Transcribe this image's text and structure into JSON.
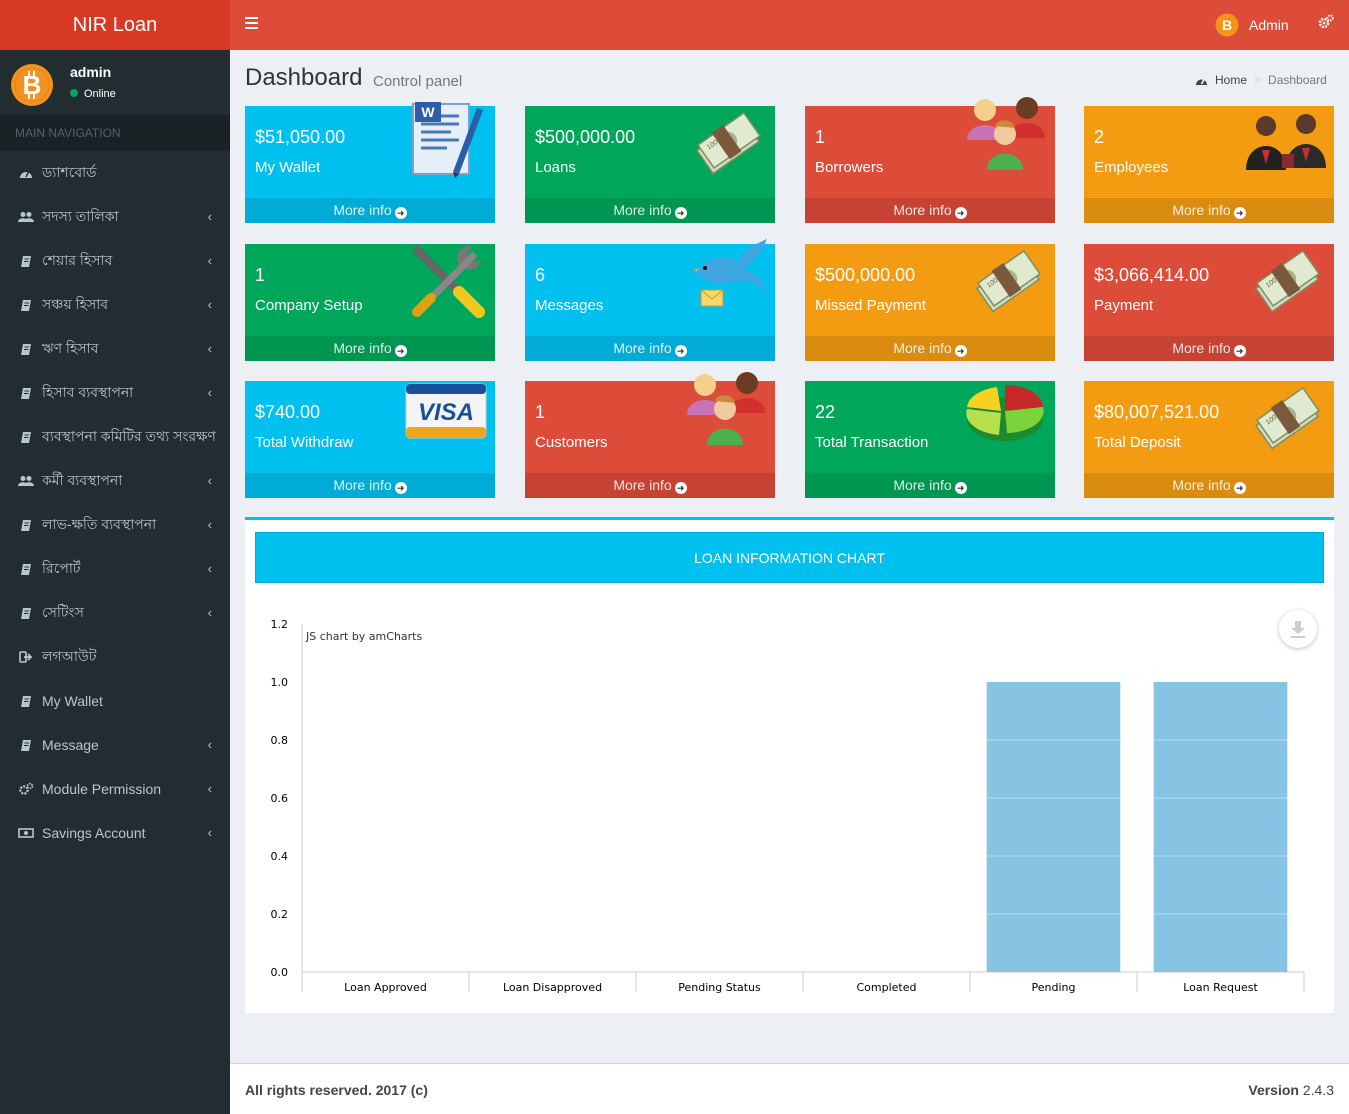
{
  "app": {
    "brand": "NIR Loan"
  },
  "user": {
    "name": "admin",
    "status": "Online"
  },
  "sidebar": {
    "header": "MAIN NAVIGATION",
    "items": [
      {
        "label": "ড্যাশবোর্ড",
        "icon": "dashboard-icon",
        "chevron": false
      },
      {
        "label": "সদস্য তালিকা",
        "icon": "users-icon",
        "chevron": true
      },
      {
        "label": "শেয়ার হিসাব",
        "icon": "book-icon",
        "chevron": true
      },
      {
        "label": "সঞ্চয় হিসাব",
        "icon": "book-icon",
        "chevron": true
      },
      {
        "label": "ঋণ হিসাব",
        "icon": "book-icon",
        "chevron": true
      },
      {
        "label": "হিসাব ব্যবস্থাপনা",
        "icon": "book-icon",
        "chevron": true
      },
      {
        "label": "ব্যবস্থাপনা কমিটির তথ্য সংরক্ষণ",
        "icon": "book-icon",
        "chevron": false
      },
      {
        "label": "কর্মী ব্যবস্থাপনা",
        "icon": "users-icon",
        "chevron": true
      },
      {
        "label": "লাভ-ক্ষতি ব্যবস্থাপনা",
        "icon": "book-icon",
        "chevron": true
      },
      {
        "label": "রিপোর্ট",
        "icon": "book-icon",
        "chevron": true
      },
      {
        "label": "সেটিংস",
        "icon": "book-icon",
        "chevron": true
      },
      {
        "label": "লগআউট",
        "icon": "sign-out-icon",
        "chevron": false
      },
      {
        "label": "My Wallet",
        "icon": "book-icon",
        "chevron": false
      },
      {
        "label": "Message",
        "icon": "book-icon",
        "chevron": true
      },
      {
        "label": "Module Permission",
        "icon": "cogs-icon",
        "chevron": true
      },
      {
        "label": "Savings Account",
        "icon": "money-icon",
        "chevron": true
      }
    ]
  },
  "topbar": {
    "admin_label": "Admin"
  },
  "page": {
    "title": "Dashboard",
    "subtitle": "Control panel"
  },
  "breadcrumb": {
    "home": "Home",
    "current": "Dashboard"
  },
  "boxes": [
    {
      "value": "$51,050.00",
      "label": "My Wallet",
      "more": "More info",
      "color": "#00c0ef",
      "icon": "document-icon"
    },
    {
      "value": "$500,000.00",
      "label": "Loans",
      "more": "More info",
      "color": "#00a65a",
      "icon": "money-stack-icon"
    },
    {
      "value": "1",
      "label": "Borrowers",
      "more": "More info",
      "color": "#dd4b39",
      "icon": "people-group-icon"
    },
    {
      "value": "2",
      "label": "Employees",
      "more": "More info",
      "color": "#f39c12",
      "icon": "employees-icon"
    },
    {
      "value": "1",
      "label": "Company Setup",
      "more": "More info",
      "color": "#00a65a",
      "icon": "tools-icon"
    },
    {
      "value": "6",
      "label": "Messages",
      "more": "More info",
      "color": "#00c0ef",
      "icon": "bird-mail-icon"
    },
    {
      "value": "$500,000.00",
      "label": "Missed Payment",
      "more": "More info",
      "color": "#f39c12",
      "icon": "money-stack-icon"
    },
    {
      "value": "$3,066,414.00",
      "label": "Payment",
      "more": "More info",
      "color": "#dd4b39",
      "icon": "money-stack-icon"
    },
    {
      "value": "$740.00",
      "label": "Total Withdraw",
      "more": "More info",
      "color": "#00c0ef",
      "icon": "visa-card-icon"
    },
    {
      "value": "1",
      "label": "Customers",
      "more": "More info",
      "color": "#dd4b39",
      "icon": "people-group-icon"
    },
    {
      "value": "22",
      "label": "Total Transaction",
      "more": "More info",
      "color": "#00a65a",
      "icon": "pie-chart-icon"
    },
    {
      "value": "$80,007,521.00",
      "label": "Total Deposit",
      "more": "More info",
      "color": "#f39c12",
      "icon": "money-stack-icon"
    }
  ],
  "chart_panel": {
    "header": "LOAN INFORMATION CHART",
    "credit": "JS chart by amCharts"
  },
  "chart_data": {
    "type": "bar",
    "categories": [
      "Loan Approved",
      "Loan Disapproved",
      "Pending Status",
      "Completed",
      "Pending",
      "Loan Request"
    ],
    "values": [
      0,
      0,
      0,
      0,
      1,
      1
    ],
    "ylim": [
      0,
      1.2
    ],
    "yticks": [
      "0.0",
      "0.2",
      "0.4",
      "0.6",
      "0.8",
      "1.0",
      "1.2"
    ],
    "bar_color": "#87c3e3",
    "grid": true
  },
  "footer": {
    "rights": "All rights reserved. 2017 (c)",
    "version_label": "Version",
    "version": "2.4.3"
  }
}
